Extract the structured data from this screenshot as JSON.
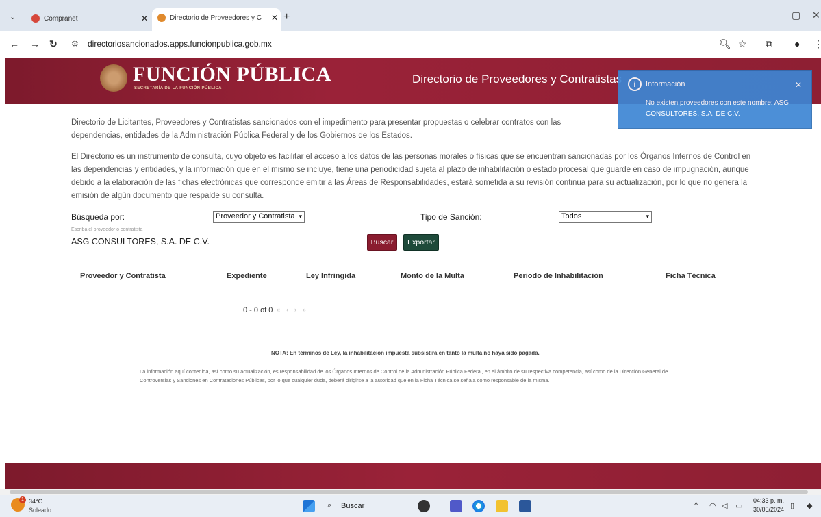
{
  "browser": {
    "tabs": [
      {
        "title": "Compranet",
        "favicon_color": "#d6473b",
        "active": false
      },
      {
        "title": "Directorio de Proveedores y C",
        "favicon_color": "#e08a2d",
        "active": true
      }
    ],
    "new_tab": "+",
    "url": "directoriosancionados.apps.funcionpublica.gob.mx"
  },
  "header": {
    "brand": "FUNCIÓN PÚBLICA",
    "brand_subtitle": "SECRETARÍA DE LA FUNCIÓN PÚBLICA",
    "page_title": "Directorio de Proveedores y Contratistas"
  },
  "toast": {
    "title": "Información",
    "message": "No existen proveedores con este nombre: ASG CONSULTORES, S.A. DE C.V."
  },
  "intro": {
    "p1": "Directorio de Licitantes, Proveedores y Contratistas sancionados con el impedimento para presentar propuestas o celebrar contratos con las dependencias, entidades de la Administración Pública Federal y de los Gobiernos de los Estados.",
    "p2": "El Directorio es un instrumento de consulta, cuyo objeto es facilitar el acceso a los datos de las personas morales o físicas que se encuentran sancionadas por los Órganos Internos de Control en las dependencias y entidades, y la información que en el mismo se incluye, tiene una periodicidad sujeta al plazo de inhabilitación o estado procesal que guarde en caso de impugnación, aunque debido a la elaboración de las fichas electrónicas que corresponde emitir a las Áreas de Responsabilidades, estará sometida a su revisión continua para su actualización, por lo que no genera la emisión de algún documento que respalde su consulta."
  },
  "form": {
    "busqueda_label": "Búsqueda por:",
    "busqueda_value": "Proveedor y Contratista",
    "tipo_label": "Tipo de Sanción:",
    "tipo_value": "Todos",
    "hint": "Escriba el proveedor o contratista",
    "search_value": "ASG CONSULTORES, S.A. DE C.V.",
    "buscar": "Buscar",
    "exportar": "Exportar"
  },
  "table": {
    "columns": [
      "Proveedor y Contratista",
      "Expediente",
      "Ley Infringida",
      "Monto de la Multa",
      "Periodo de Inhabilitación",
      "Ficha Técnica"
    ],
    "pagination": "0 - 0 of 0"
  },
  "footer": {
    "nota": "NOTA: En términos de Ley, la inhabilitación impuesta subsistirá en tanto la multa no haya sido pagada.",
    "disclaimer": "La información aquí contenida, así como su actualización, es responsabilidad de los Órganos Internos de Control de la Administración Pública Federal, en el ámbito de su respectiva competencia, así como de la Dirección General de Controversias y Sanciones en Contrataciones Públicas, por lo que cualquier duda, deberá dirigirse a la autoridad que en la Ficha Técnica se señala como responsable de la misma."
  },
  "taskbar": {
    "temperature": "34°C",
    "weather": "Soleado",
    "search": "Buscar",
    "time": "04:33 p. m.",
    "date": "30/05/2024"
  }
}
